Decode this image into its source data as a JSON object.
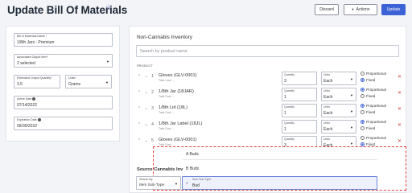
{
  "header": {
    "title": "Update Bill Of Materials",
    "discard_label": "Discard",
    "actions_label": "Actions",
    "update_label": "Update"
  },
  "form": {
    "bom_name": {
      "label": "Bill of Materials Name *",
      "value": "1/8th Jars - Premium"
    },
    "output_item": {
      "label": "Associated Output Item*",
      "value": "2 selected"
    },
    "output_qty": {
      "label": "Estimated Output Quantity*",
      "value": "3.5"
    },
    "units": {
      "label": "Units*",
      "value": "Grams"
    },
    "active_date": {
      "label": "Active Date",
      "value": "07/14/2022"
    },
    "expiration_date": {
      "label": "Expiration Date",
      "value": "09/30/2022"
    }
  },
  "inventory": {
    "title": "Non-Cannabis Inventory",
    "search_placeholder": "Search by product name",
    "column_product": "PRODUCT",
    "qty_label": "Quantity",
    "units_label": "Units",
    "proportional_label": "Proportional",
    "fixed_label": "Fixed",
    "rows": [
      {
        "name": "Gloves (GLV-0001)",
        "cost": "Total Cost: --",
        "qty": "3",
        "unit": "Each",
        "chev": "⌃ ⌄ 1",
        "prop_on": false
      },
      {
        "name": "1/8th Jar (18JAR)",
        "cost": "Total Cost: --",
        "qty": "1",
        "unit": "Each",
        "chev": "⌃ ⌄ 2",
        "prop_on": true
      },
      {
        "name": "1/8th Lid (18L)",
        "cost": "Total Cost: --",
        "qty": "1",
        "unit": "Each",
        "chev": "⌃ ⌄ 3",
        "prop_on": true
      },
      {
        "name": "1/8th Jar Label (18JL)",
        "cost": "Total Cost: --",
        "qty": "1",
        "unit": "Each",
        "chev": "⌃ ⌄ 4",
        "prop_on": true
      },
      {
        "name": "Gloves (GLV-0001)",
        "cost": "Total Cost: --",
        "qty": "3",
        "unit": "Each",
        "chev": "⌃ ⌄ 5",
        "prop_on": false
      }
    ]
  },
  "source": {
    "title": "Source Cannabis Inv",
    "search_by_label": "Search By",
    "search_by_value": "Item Sub-Type",
    "subtype_label": "Item Sub-Type",
    "subtype_value": "Bud",
    "options": [
      "A Buds",
      "B Buds"
    ]
  },
  "colors": {
    "accent": "#3b63d6",
    "danger": "#d23b3b",
    "popup_border": "#e03b3b"
  }
}
